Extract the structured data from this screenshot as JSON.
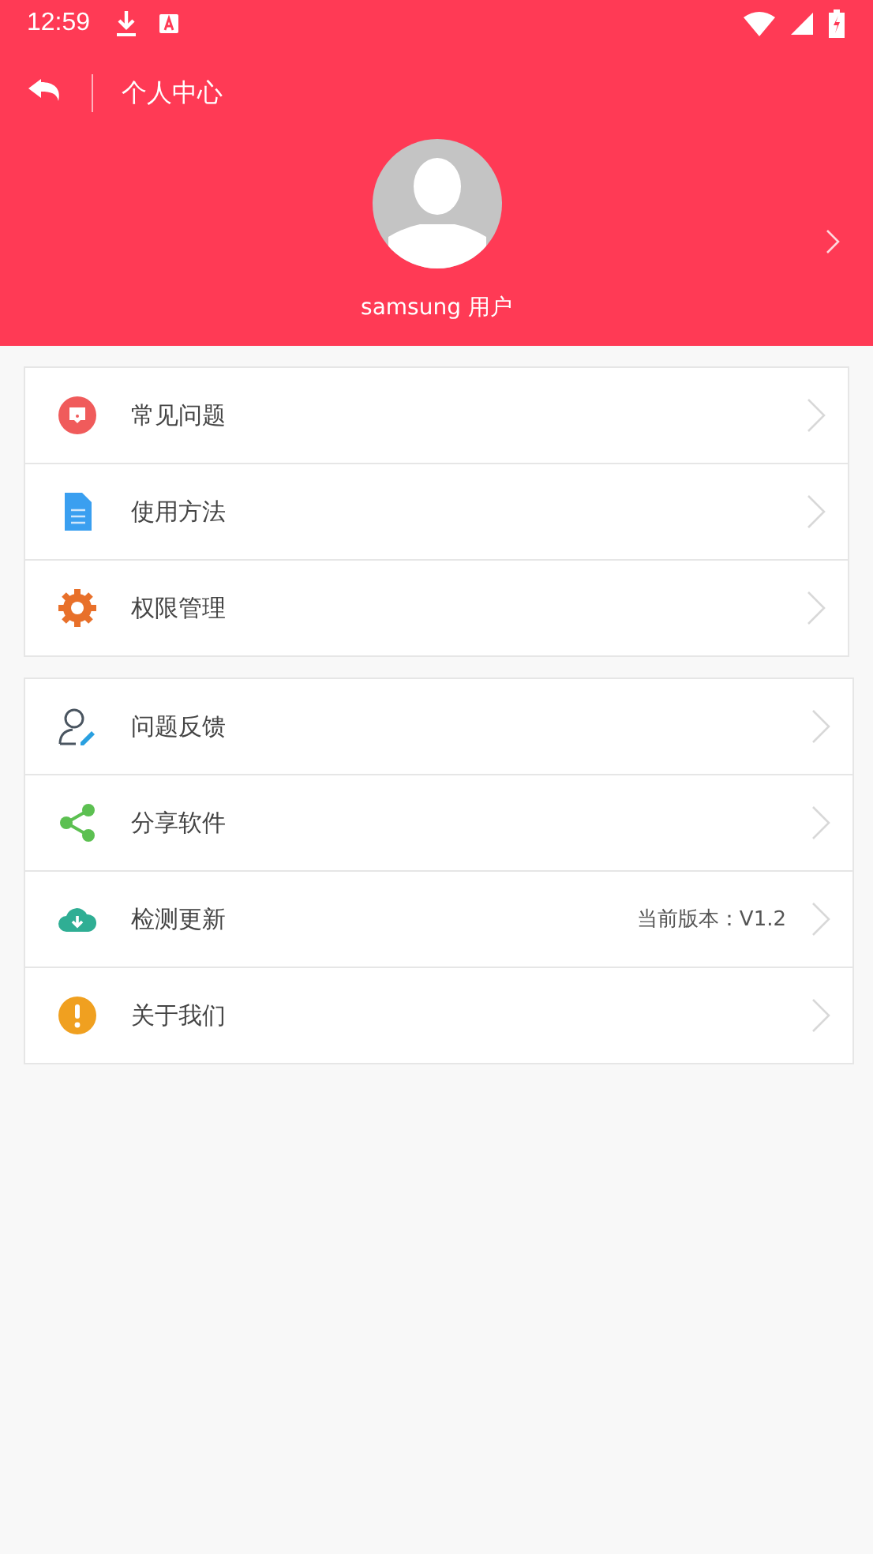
{
  "status_bar": {
    "time": "12:59"
  },
  "header": {
    "title": "个人中心",
    "username": "samsung 用户"
  },
  "groups": [
    {
      "items": [
        {
          "kind": "question",
          "label": "常见问题"
        },
        {
          "kind": "document",
          "label": "使用方法"
        },
        {
          "kind": "gear",
          "label": "权限管理"
        }
      ]
    },
    {
      "items": [
        {
          "kind": "feedback",
          "label": "问题反馈"
        },
        {
          "kind": "share",
          "label": "分享软件"
        },
        {
          "kind": "update",
          "label": "检测更新",
          "value": "当前版本：V1.2"
        },
        {
          "kind": "about",
          "label": "关于我们"
        }
      ]
    }
  ]
}
